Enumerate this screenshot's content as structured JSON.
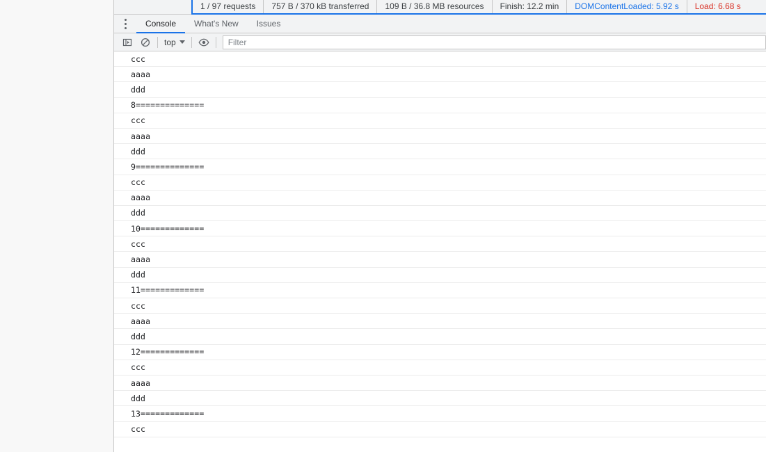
{
  "network_summary": {
    "items": [
      {
        "label": "1 / 97 requests",
        "tone": "default"
      },
      {
        "label": "757 B / 370 kB transferred",
        "tone": "default"
      },
      {
        "label": "109 B / 36.8 MB resources",
        "tone": "default"
      },
      {
        "label": "Finish: 12.2 min",
        "tone": "default"
      },
      {
        "label": "DOMContentLoaded: 5.92 s",
        "tone": "blue"
      },
      {
        "label": "Load: 6.68 s",
        "tone": "red"
      }
    ],
    "colors": {
      "blue": "#1a73e8",
      "red": "#d93025",
      "default": "#3c4043",
      "accent_border": "#1a73e8"
    }
  },
  "tabstrip": {
    "more_icon": "kebab-menu-icon",
    "tabs": [
      {
        "label": "Console",
        "active": true
      },
      {
        "label": "What's New",
        "active": false
      },
      {
        "label": "Issues",
        "active": false
      }
    ]
  },
  "toolbar": {
    "sidebar_toggle_icon": "console-sidebar-icon",
    "clear_console_icon": "clear-console-icon",
    "context_selector": {
      "value": "top",
      "caret_icon": "chevron-down-icon"
    },
    "live_expression_icon": "eye-icon",
    "filter": {
      "placeholder": "Filter",
      "value": ""
    }
  },
  "console": {
    "messages": [
      {
        "text": "ccc"
      },
      {
        "text": "aaaa"
      },
      {
        "text": "ddd"
      },
      {
        "text": "8=============="
      },
      {
        "text": "ccc"
      },
      {
        "text": "aaaa"
      },
      {
        "text": "ddd"
      },
      {
        "text": "9=============="
      },
      {
        "text": "ccc"
      },
      {
        "text": "aaaa"
      },
      {
        "text": "ddd"
      },
      {
        "text": "10============="
      },
      {
        "text": "ccc"
      },
      {
        "text": "aaaa"
      },
      {
        "text": "ddd"
      },
      {
        "text": "11============="
      },
      {
        "text": "ccc"
      },
      {
        "text": "aaaa"
      },
      {
        "text": "ddd"
      },
      {
        "text": "12============="
      },
      {
        "text": "ccc"
      },
      {
        "text": "aaaa"
      },
      {
        "text": "ddd"
      },
      {
        "text": "13============="
      },
      {
        "text": "ccc"
      }
    ]
  }
}
